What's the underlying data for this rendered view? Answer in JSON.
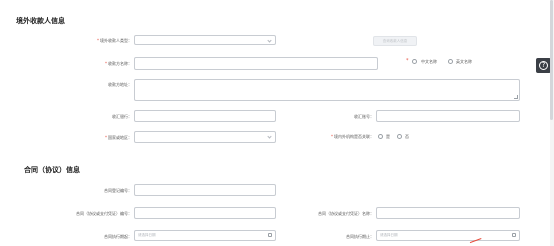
{
  "section1": {
    "title": "境外收款人信息",
    "payee_type": {
      "label": "境外收款人类型：",
      "value": ""
    },
    "check_button": "查询收款人信息",
    "payee_name": {
      "label": "收款方名称：",
      "value": ""
    },
    "name_lang": {
      "option_cn": "中文名称",
      "option_en": "英文名称"
    },
    "payee_address": {
      "label": "收款方地址：",
      "value": ""
    },
    "bank": {
      "label": "收汇银行：",
      "value": ""
    },
    "account": {
      "label": "收汇账号：",
      "value": ""
    },
    "country": {
      "label": "国家或地区：",
      "value": ""
    },
    "related": {
      "label": "境内外机构是否关联：",
      "yes": "是",
      "no": "否"
    }
  },
  "section2": {
    "title": "合同（协议）信息",
    "reg_no": {
      "label": "合同登记编号：",
      "value": ""
    },
    "contract_no": {
      "label": "合同（协议或支付凭证）编号：",
      "value": ""
    },
    "contract_name": {
      "label": "合同（协议或支付凭证）名称：",
      "value": ""
    },
    "start_date": {
      "label": "合同执行期起：",
      "placeholder": "请选择日期"
    },
    "end_date": {
      "label": "合同执行期止：",
      "placeholder": "请选择日期"
    }
  },
  "side": {
    "icon": "help-circle-icon"
  }
}
